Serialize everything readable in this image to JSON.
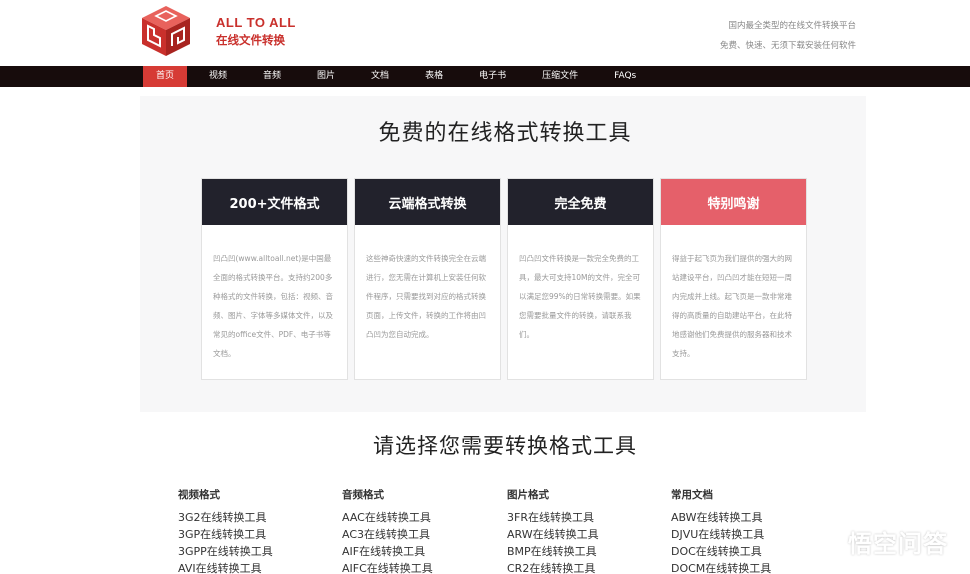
{
  "header": {
    "brand_en": "ALL TO ALL",
    "brand_cn": "在线文件转换",
    "tagline_line1": "国内最全类型的在线文件转换平台",
    "tagline_line2": "免费、快速、无须下载安装任何软件"
  },
  "nav": {
    "items": [
      "首页",
      "视频",
      "音频",
      "图片",
      "文档",
      "表格",
      "电子书",
      "压缩文件",
      "FAQs"
    ],
    "active_index": 0
  },
  "section1": {
    "title": "免费的在线格式转换工具"
  },
  "cards": [
    {
      "title": "200+文件格式",
      "body": "凹凸凹(www.alltoall.net)是中国最全面的格式转换平台。支持约200多种格式的文件转换，包括：视频、音频、图片、字体等多媒体文件，以及常见的office文件、PDF、电子书等文档。"
    },
    {
      "title": "云端格式转换",
      "body": "这些神奇快速的文件转换完全在云端进行，您无需在计算机上安装任何软件程序，只需要找到对应的格式转换页面，上传文件，转换的工作将由凹凸凹为您自动完成。"
    },
    {
      "title": "完全免费",
      "body": "凹凸凹文件转换是一款完全免费的工具，最大可支持10M的文件，完全可以满足您99%的日常转换需要。如果您需要批量文件的转换，请联系我们。"
    },
    {
      "title": "特别鸣谢",
      "body": "得益于起飞页为我们提供的强大的网站建设平台，凹凸凹才能在短短一周内完成并上线。起飞页是一款非常难得的高质量的自助建站平台，在此特地感谢他们免费提供的服务器和技术支持。"
    }
  ],
  "section2": {
    "title": "请选择您需要转换格式工具"
  },
  "columns": [
    {
      "title": "视频格式",
      "items": [
        "3G2在线转换工具",
        "3GP在线转换工具",
        "3GPP在线转换工具",
        "AVI在线转换工具"
      ]
    },
    {
      "title": "音频格式",
      "items": [
        "AAC在线转换工具",
        "AC3在线转换工具",
        "AIF在线转换工具",
        "AIFC在线转换工具"
      ]
    },
    {
      "title": "图片格式",
      "items": [
        "3FR在线转换工具",
        "ARW在线转换工具",
        "BMP在线转换工具",
        "CR2在线转换工具"
      ]
    },
    {
      "title": "常用文档",
      "items": [
        "ABW在线转换工具",
        "DJVU在线转换工具",
        "DOC在线转换工具",
        "DOCM在线转换工具"
      ]
    }
  ],
  "watermark": {
    "text": "悟空问答"
  },
  "colors": {
    "brand_red": "#c9302c",
    "nav_bg": "#170c0c",
    "nav_active": "#d63b35",
    "card_dark": "#22222c",
    "card_pink": "#e5606a"
  }
}
